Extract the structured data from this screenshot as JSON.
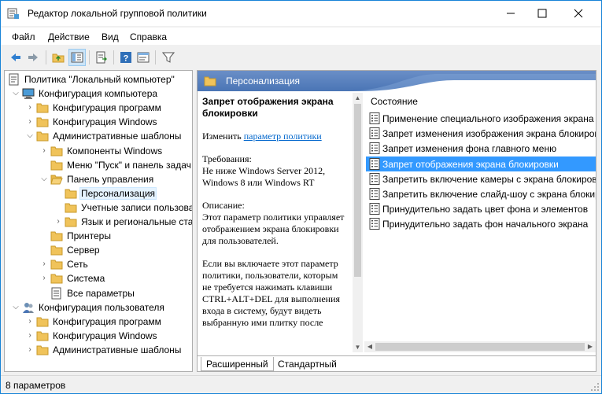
{
  "window": {
    "title": "Редактор локальной групповой политики"
  },
  "menu": [
    "Файл",
    "Действие",
    "Вид",
    "Справка"
  ],
  "toolbar": {
    "icons": [
      "back-icon",
      "forward-icon",
      "up-folder-icon",
      "show-hide-tree-icon",
      "export-list-icon",
      "help-icon",
      "properties-icon",
      "filter-icon"
    ]
  },
  "tree": [
    {
      "label": "Политика \"Локальный компьютер\"",
      "level": 0,
      "exp": "",
      "icon": "policy"
    },
    {
      "label": "Конфигурация компьютера",
      "level": 1,
      "exp": "⌵",
      "icon": "computer"
    },
    {
      "label": "Конфигурация программ",
      "level": 2,
      "exp": "›",
      "icon": "folder"
    },
    {
      "label": "Конфигурация Windows",
      "level": 2,
      "exp": "›",
      "icon": "folder"
    },
    {
      "label": "Административные шаблоны",
      "level": 2,
      "exp": "⌵",
      "icon": "folder"
    },
    {
      "label": "Компоненты Windows",
      "level": 3,
      "exp": "›",
      "icon": "folder"
    },
    {
      "label": "Меню \"Пуск\" и панель задач",
      "level": 3,
      "exp": "",
      "icon": "folder"
    },
    {
      "label": "Панель управления",
      "level": 3,
      "exp": "⌵",
      "icon": "folder-open"
    },
    {
      "label": "Персонализация",
      "level": 4,
      "exp": "",
      "icon": "folder",
      "selected": true
    },
    {
      "label": "Учетные записи пользователей",
      "level": 4,
      "exp": "",
      "icon": "folder"
    },
    {
      "label": "Язык и региональные стандарты",
      "level": 4,
      "exp": "›",
      "icon": "folder"
    },
    {
      "label": "Принтеры",
      "level": 3,
      "exp": "",
      "icon": "folder"
    },
    {
      "label": "Сервер",
      "level": 3,
      "exp": "",
      "icon": "folder"
    },
    {
      "label": "Сеть",
      "level": 3,
      "exp": "›",
      "icon": "folder"
    },
    {
      "label": "Система",
      "level": 3,
      "exp": "›",
      "icon": "folder"
    },
    {
      "label": "Все параметры",
      "level": 3,
      "exp": "",
      "icon": "settings"
    },
    {
      "label": "Конфигурация пользователя",
      "level": 1,
      "exp": "⌵",
      "icon": "user"
    },
    {
      "label": "Конфигурация программ",
      "level": 2,
      "exp": "›",
      "icon": "folder"
    },
    {
      "label": "Конфигурация Windows",
      "level": 2,
      "exp": "›",
      "icon": "folder"
    },
    {
      "label": "Административные шаблоны",
      "level": 2,
      "exp": "›",
      "icon": "folder"
    }
  ],
  "right": {
    "header": "Персонализация",
    "description": {
      "title": "Запрет отображения экрана блокировки",
      "edit_prefix": "Изменить",
      "edit_link": "параметр политики",
      "requirements_label": "Требования:",
      "requirements": "Не ниже Windows Server 2012, Windows 8 или Windows RT",
      "desc_label": "Описание:",
      "desc_1": "Этот параметр политики управляет отображением экрана блокировки для пользователей.",
      "desc_2": "Если вы включаете этот параметр политики, пользователи, которым не требуется нажимать клавиши CTRL+ALT+DEL для выполнения входа в систему, будут видеть выбранную ими плитку после"
    },
    "list_header": "Состояние",
    "settings": [
      "Применение специального изображения экрана",
      "Запрет изменения изображения экрана блокировки",
      "Запрет изменения фона главного меню",
      "Запрет отображения экрана блокировки",
      "Запретить включение камеры с экрана блокировки",
      "Запретить включение слайд-шоу с экрана блокировки",
      "Принудительно задать цвет фона и элементов",
      "Принудительно задать фон начального экрана"
    ],
    "selected_index": 3,
    "tabs": [
      "Расширенный",
      "Стандартный"
    ]
  },
  "status": "8 параметров",
  "colors": {
    "accent": "#1883d7",
    "header_blue": "#4a75b5",
    "selection": "#3399ff",
    "tree_selection": "#e5f3ff",
    "folder": "#f0c35a",
    "link": "#0066cc"
  }
}
